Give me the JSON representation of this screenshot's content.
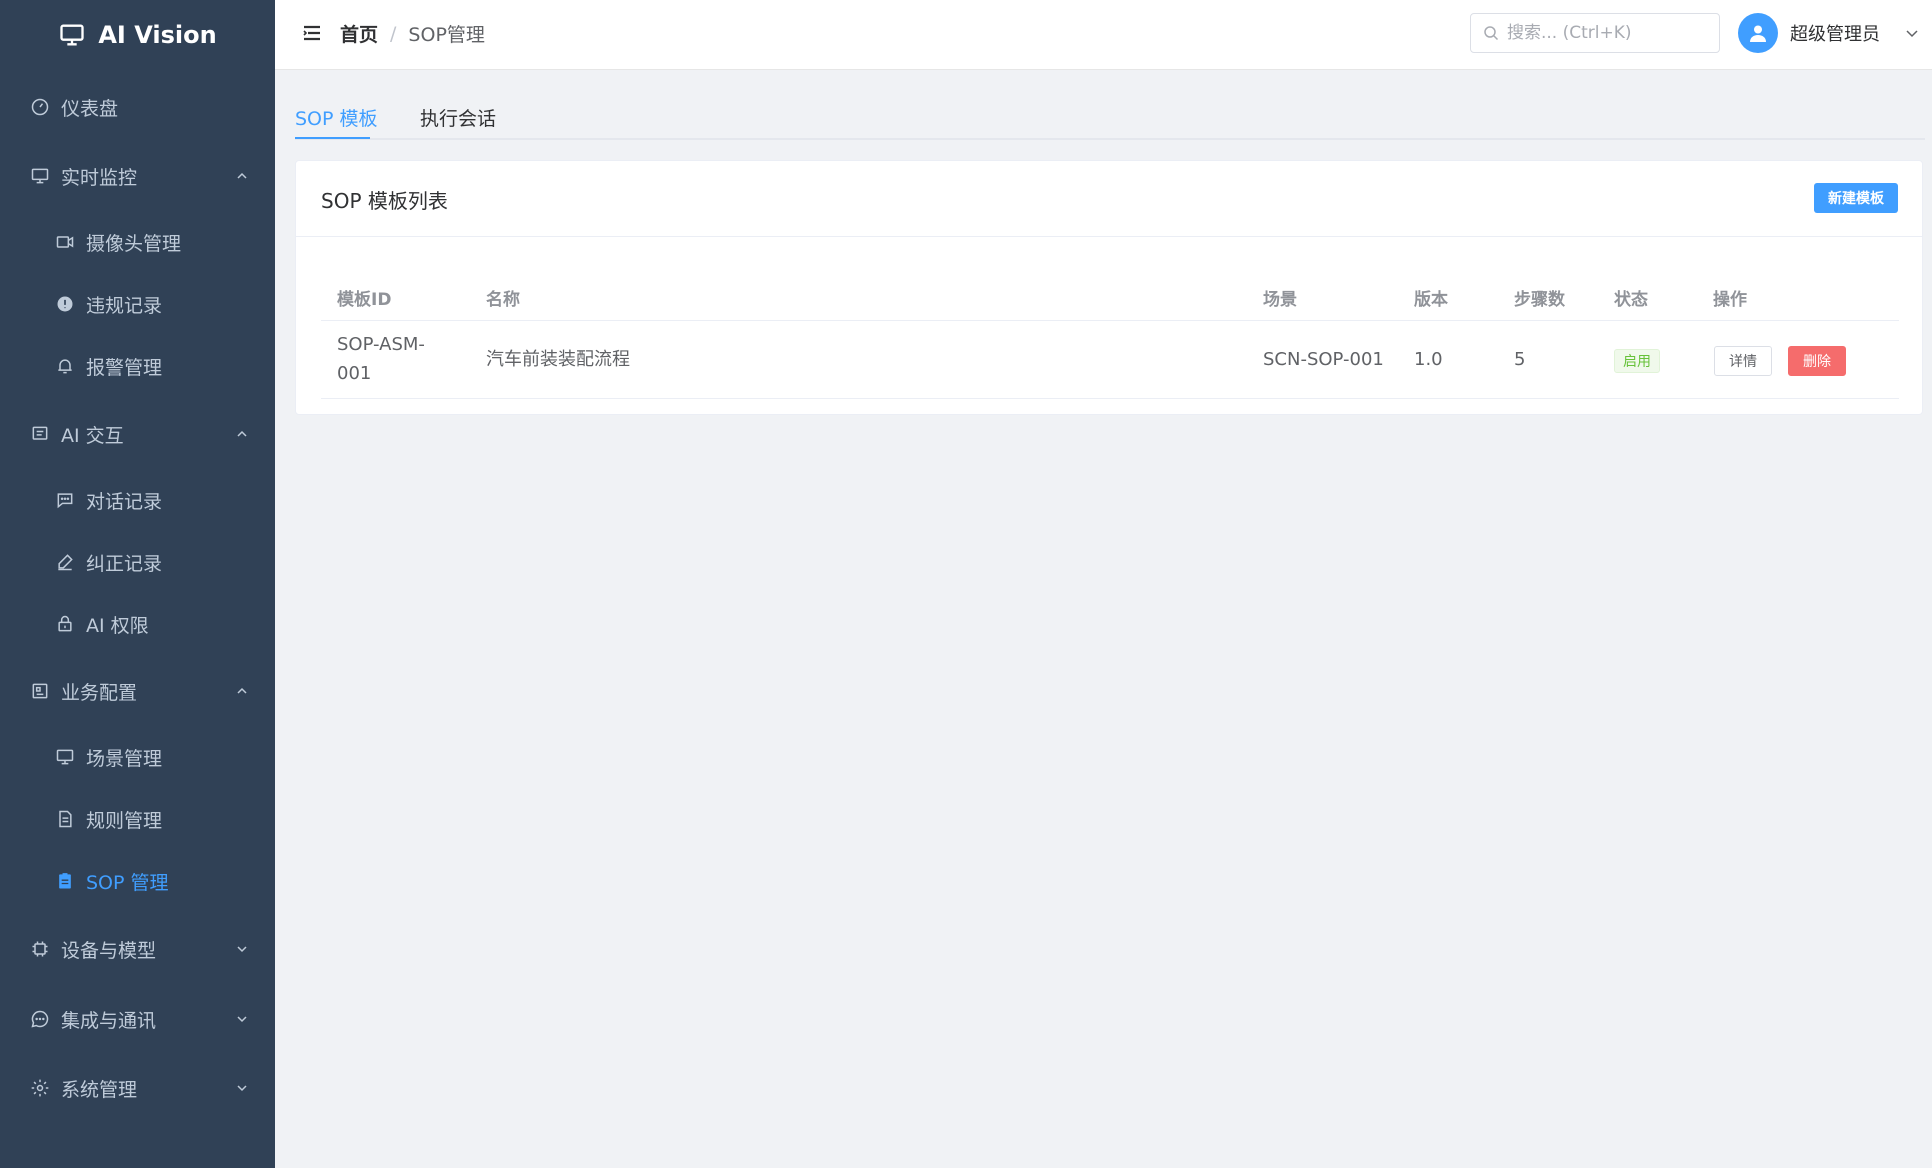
{
  "app": {
    "title": "AI Vision"
  },
  "sidebar": {
    "items": [
      {
        "label": "仪表盘",
        "icon": "dashboard-icon"
      },
      {
        "label": "实时监控",
        "icon": "monitor-icon"
      },
      {
        "label": "摄像头管理",
        "icon": "camera-icon"
      },
      {
        "label": "违规记录",
        "icon": "warning-icon"
      },
      {
        "label": "报警管理",
        "icon": "bell-icon"
      },
      {
        "label": "AI 交互",
        "icon": "chat-box-icon"
      },
      {
        "label": "对话记录",
        "icon": "chat-dots-icon"
      },
      {
        "label": "纠正记录",
        "icon": "edit-pen-icon"
      },
      {
        "label": "AI 权限",
        "icon": "lock-icon"
      },
      {
        "label": "业务配置",
        "icon": "config-icon"
      },
      {
        "label": "场景管理",
        "icon": "monitor-icon"
      },
      {
        "label": "规则管理",
        "icon": "document-icon"
      },
      {
        "label": "SOP 管理",
        "icon": "clipboard-icon"
      },
      {
        "label": "设备与模型",
        "icon": "cpu-icon"
      },
      {
        "label": "集成与通讯",
        "icon": "chat-round-icon"
      },
      {
        "label": "系统管理",
        "icon": "gear-icon"
      }
    ],
    "active": "SOP 管理"
  },
  "header": {
    "breadcrumb_home": "首页",
    "breadcrumb_sep": "/",
    "breadcrumb_current": "SOP管理",
    "search_placeholder": "搜索... (Ctrl+K)",
    "username": "超级管理员"
  },
  "tabs": [
    {
      "label": "SOP 模板",
      "active": true
    },
    {
      "label": "执行会话",
      "active": false
    }
  ],
  "card": {
    "title": "SOP 模板列表",
    "new_button": "新建模板"
  },
  "table": {
    "columns": [
      "模板ID",
      "名称",
      "场景",
      "版本",
      "步骤数",
      "状态",
      "操作"
    ],
    "rows": [
      {
        "id_line1": "SOP-ASM-",
        "id_line2": "001",
        "name": "汽车前装装配流程",
        "scene": "SCN-SOP-001",
        "version": "1.0",
        "steps": "5",
        "status": "启用",
        "detail": "详情",
        "delete": "删除"
      }
    ]
  },
  "colors": {
    "sidebar_bg": "#304156",
    "accent": "#409eff",
    "success": "#67c23a",
    "danger": "#f56c6c"
  }
}
